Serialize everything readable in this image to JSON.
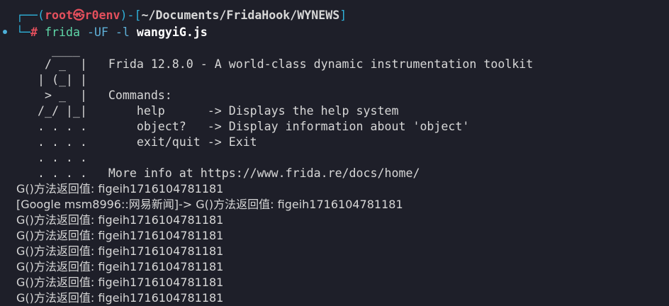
{
  "prompt": {
    "corner_top": "┌──(",
    "user_host": "root㉿r0env",
    "close_dash_open": ")-[",
    "cwd": "~/Documents/FridaHook/WYNEWS",
    "close_bracket": "]",
    "corner_bottom": "└─",
    "hash": "#"
  },
  "command": {
    "program": "frida",
    "args": "-UF -l",
    "script_file": "wangyiG.js"
  },
  "banner": [
    "     ____",
    "    / _  |   Frida 12.8.0 - A world-class dynamic instrumentation toolkit",
    "   | (_| |",
    "    > _  |   Commands:",
    "   /_/ |_|       help      -> Displays the help system",
    "   . . . .       object?   -> Display information about 'object'",
    "   . . . .       exit/quit -> Exit",
    "   . . . .",
    "   . . . .   More info at https://www.frida.re/docs/home/"
  ],
  "log_lines": [
    "G()方法返回值: figeih1716104781181",
    "[Google msm8996::网易新闻]-> G()方法返回值: figeih1716104781181",
    "G()方法返回值: figeih1716104781181",
    "G()方法返回值: figeih1716104781181",
    "G()方法返回值: figeih1716104781181",
    "G()方法返回值: figeih1716104781181",
    "G()方法返回值: figeih1716104781181",
    "G()方法返回值: figeih1716104781181"
  ],
  "colors": {
    "background": "#1e1f29",
    "prompt_bar": "#2fb0d8",
    "user_host": "#e34f5c",
    "command": "#5fd7a8",
    "args": "#5fb0d8"
  }
}
